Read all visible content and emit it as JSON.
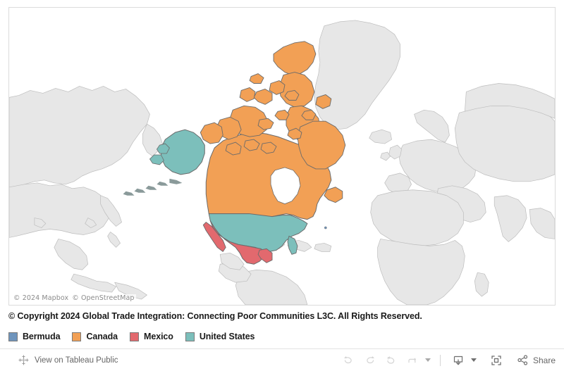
{
  "map": {
    "attribution_mapbox": "© 2024 Mapbox",
    "attribution_osm": "© OpenStreetMap",
    "colors": {
      "bermuda": "#6f95bd",
      "canada": "#f2a055",
      "mexico": "#e2696e",
      "united_states": "#7cbfbb",
      "other_land": "#e6e6e6",
      "other_land_border": "#b9b9b9",
      "selected_border": "#6b6b6b",
      "water": "#ffffff"
    }
  },
  "caption": {
    "text": "© Copyright 2024 Global Trade Integration: Connecting Poor Communities L3C. All Rights Reserved."
  },
  "legend": {
    "items": [
      {
        "label": "Bermuda",
        "color": "#6f95bd"
      },
      {
        "label": "Canada",
        "color": "#f2a055"
      },
      {
        "label": "Mexico",
        "color": "#e2696e"
      },
      {
        "label": "United States",
        "color": "#7cbfbb"
      }
    ]
  },
  "toolbar": {
    "view_on_tableau_public": "View on Tableau Public",
    "tableau_icon": "tableau-logo-icon",
    "buttons": [
      {
        "name": "undo",
        "icon": "undo-icon",
        "enabled": false
      },
      {
        "name": "redo",
        "icon": "redo-icon",
        "enabled": false
      },
      {
        "name": "revert",
        "icon": "revert-icon",
        "enabled": false
      },
      {
        "name": "refresh",
        "icon": "refresh-icon",
        "enabled": false
      }
    ],
    "refresh_caret": "chevron-down-icon",
    "download": {
      "name": "download",
      "icon": "download-icon",
      "caret": "chevron-down-icon"
    },
    "fullscreen": {
      "name": "fullscreen",
      "icon": "fullscreen-icon"
    },
    "share": {
      "label": "Share",
      "icon": "share-icon"
    }
  }
}
